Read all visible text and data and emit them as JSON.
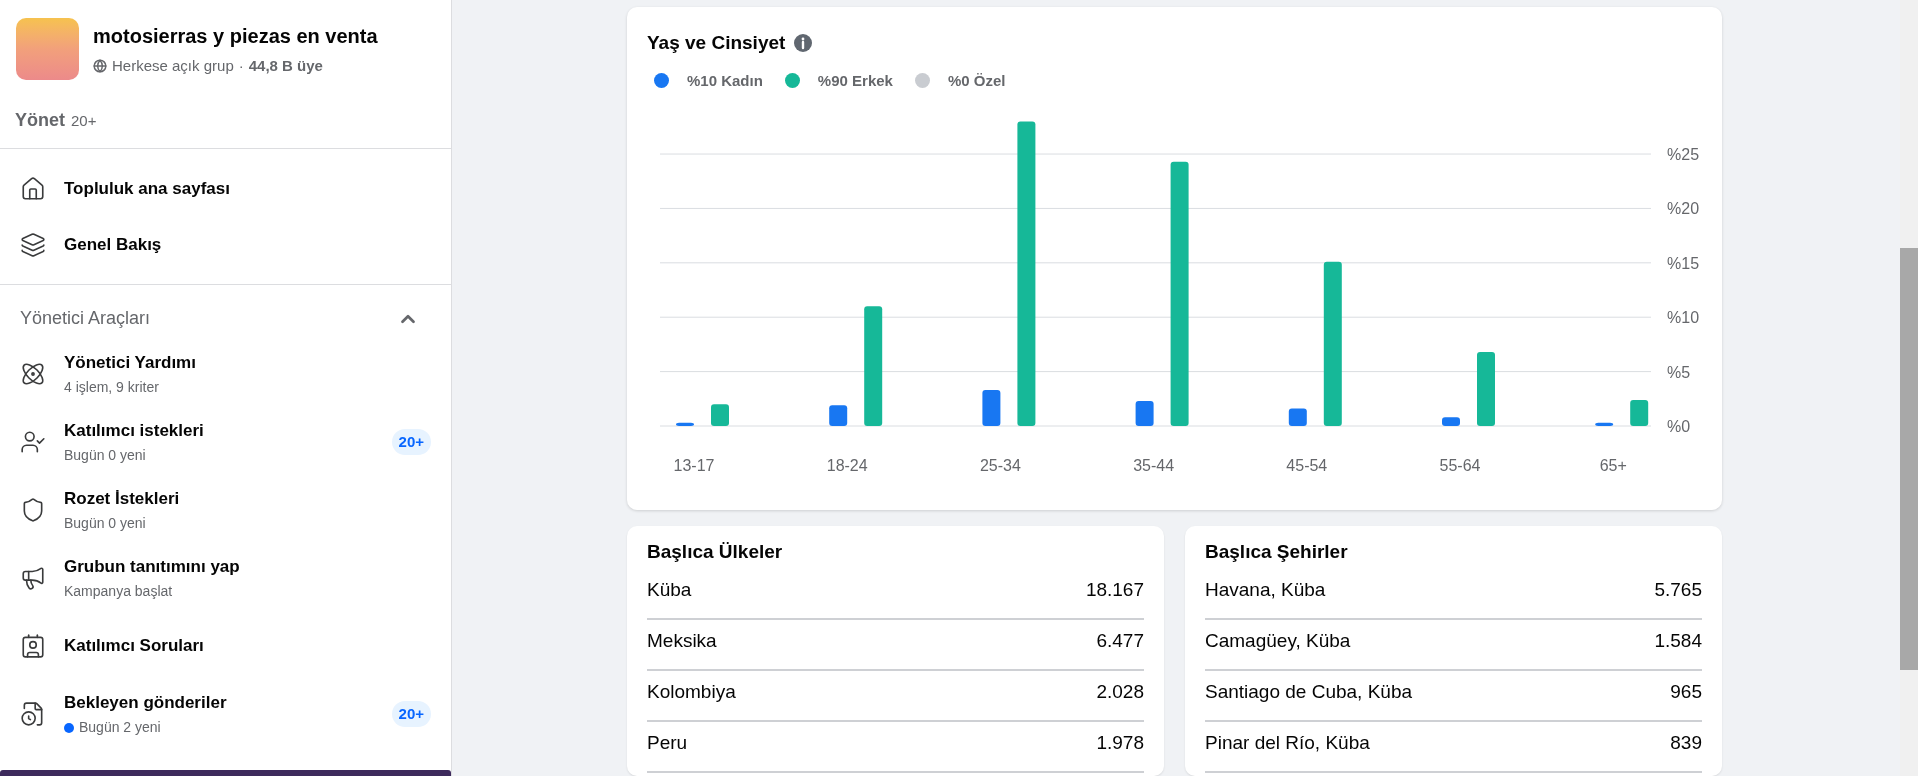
{
  "group": {
    "name": "motosierras y piezas en venta",
    "privacy": "Herkese açık grup",
    "separator": "·",
    "members": "44,8 B üye"
  },
  "manage": {
    "label": "Yönet",
    "count": "20+"
  },
  "nav": [
    {
      "kind": "home",
      "label": "Topluluk ana sayfası"
    },
    {
      "kind": "overview",
      "label": "Genel Bakış"
    }
  ],
  "admin_tools": {
    "title": "Yönetici Araçları",
    "expanded": true,
    "items": [
      {
        "kind": "admin-help",
        "label": "Yönetici Yardımı",
        "subtitle": "4 işlem, 9 kriter"
      },
      {
        "kind": "member-requests",
        "label": "Katılımcı istekleri",
        "subtitle": "Bugün 0 yeni",
        "badge": "20+"
      },
      {
        "kind": "badge-requests",
        "label": "Rozet İstekleri",
        "subtitle": "Bugün 0 yeni"
      },
      {
        "kind": "promote",
        "label": "Grubun tanıtımını yap",
        "subtitle": "Kampanya başlat"
      },
      {
        "kind": "questions",
        "label": "Katılımcı Soruları"
      },
      {
        "kind": "pending",
        "label": "Bekleyen gönderiler",
        "subtitle": "Bugün 2 yeni",
        "unread": true,
        "badge": "20+"
      }
    ]
  },
  "age_gender": {
    "title": "Yaş ve Cinsiyet",
    "chart_data": {
      "type": "bar",
      "categories": [
        "13-17",
        "18-24",
        "25-34",
        "35-44",
        "45-54",
        "55-64",
        "65+"
      ],
      "series": [
        {
          "name": "%10 Kadın",
          "color": "#1877f2",
          "values": [
            0.3,
            1.9,
            3.3,
            2.3,
            1.6,
            0.8,
            0.3
          ]
        },
        {
          "name": "%90 Erkek",
          "color": "#16b898",
          "values": [
            2.0,
            11.0,
            28.0,
            24.3,
            15.1,
            6.8,
            2.4
          ]
        },
        {
          "name": "%0 Özel",
          "color": "#c9ccd1",
          "values": [
            0,
            0,
            0,
            0,
            0,
            0,
            0
          ]
        }
      ],
      "ylim": [
        0,
        28
      ],
      "grid": true,
      "yticks": [
        {
          "value": 0,
          "label": "%0"
        },
        {
          "value": 5,
          "label": "%5"
        },
        {
          "value": 10,
          "label": "%10"
        },
        {
          "value": 15,
          "label": "%15"
        },
        {
          "value": 20,
          "label": "%20"
        },
        {
          "value": 25,
          "label": "%25"
        }
      ]
    }
  },
  "top_countries": {
    "title": "Başlıca Ülkeler",
    "rows": [
      {
        "name": "Küba",
        "value": "18.167"
      },
      {
        "name": "Meksika",
        "value": "6.477"
      },
      {
        "name": "Kolombiya",
        "value": "2.028"
      },
      {
        "name": "Peru",
        "value": "1.978"
      }
    ]
  },
  "top_cities": {
    "title": "Başlıca Şehirler",
    "rows": [
      {
        "name": "Havana, Küba",
        "value": "5.765"
      },
      {
        "name": "Camagüey, Küba",
        "value": "1.584"
      },
      {
        "name": "Santiago de Cuba, Küba",
        "value": "965"
      },
      {
        "name": "Pinar del Río, Küba",
        "value": "839"
      }
    ]
  }
}
